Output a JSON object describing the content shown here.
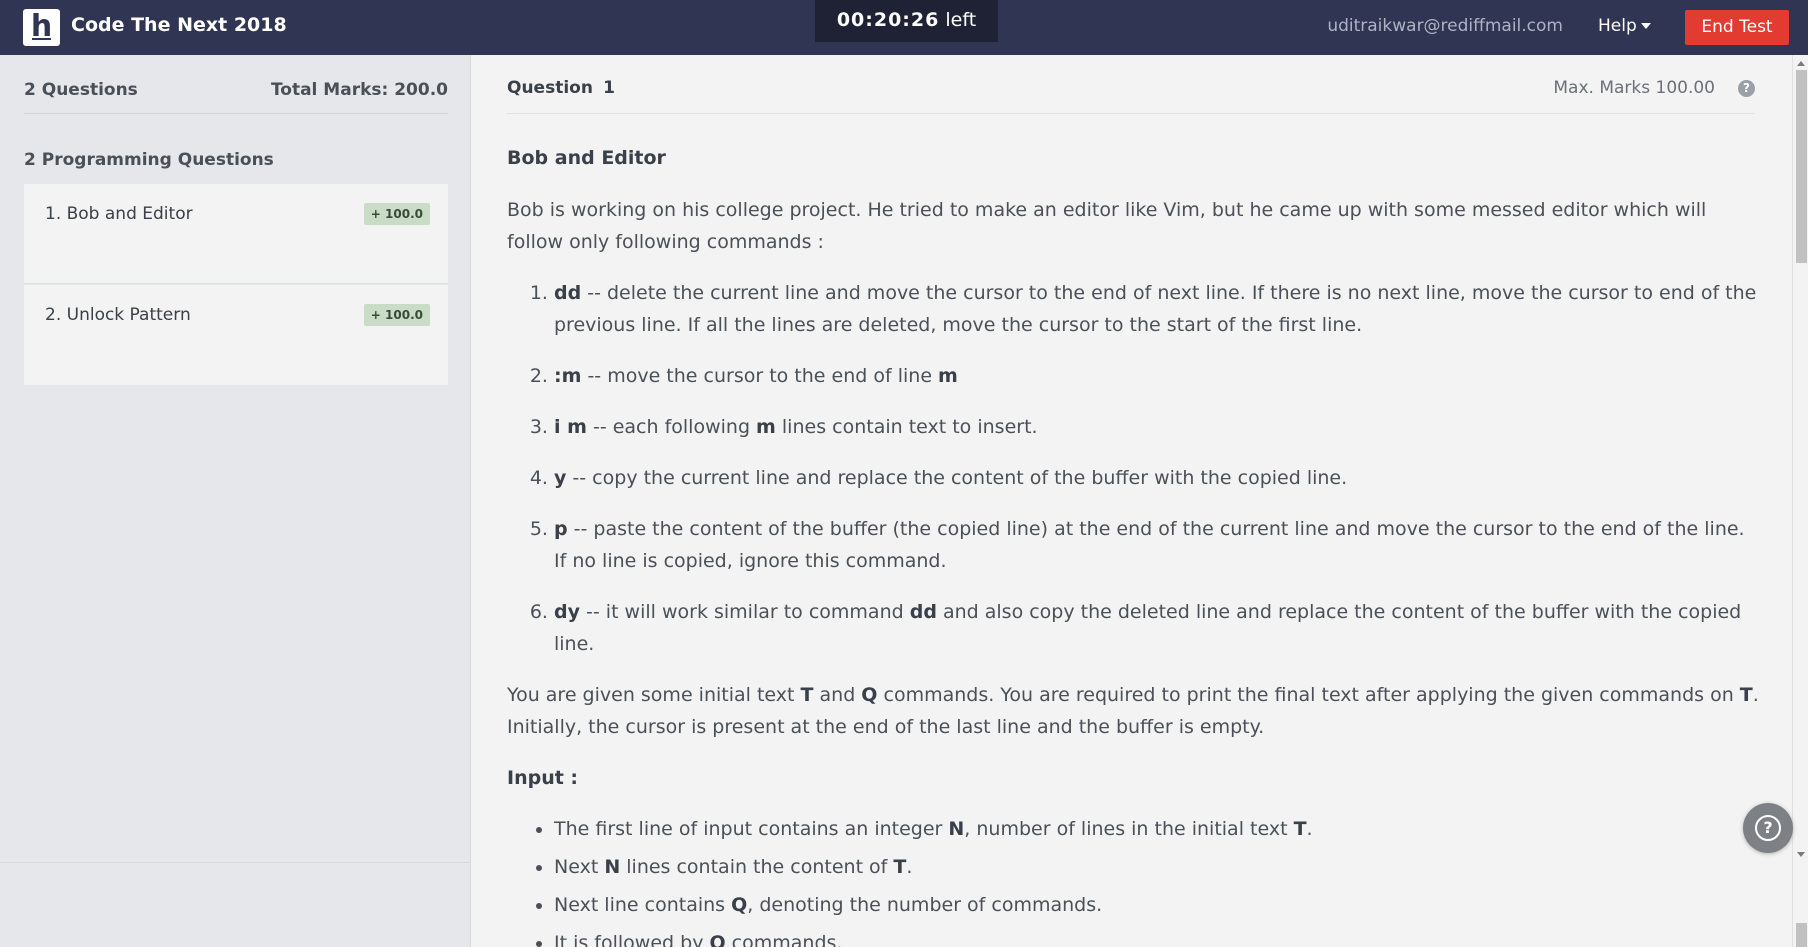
{
  "header": {
    "logo_letter": "h",
    "app_title": "Code The Next 2018",
    "timer": {
      "time": "00:20:26",
      "suffix": "left"
    },
    "user_email": "uditraikwar@rediffmail.com",
    "help_label": "Help",
    "end_test_label": "End Test"
  },
  "sidebar": {
    "question_count": "2 Questions",
    "total_marks": "Total Marks: 200.0",
    "section_title": "2 Programming Questions",
    "questions": [
      {
        "name": "1. Bob and Editor",
        "badge": "+ 100.0"
      },
      {
        "name": "2. Unlock Pattern",
        "badge": "+ 100.0"
      }
    ]
  },
  "question": {
    "label": "Question",
    "number": "1",
    "max_marks": "Max. Marks 100.00",
    "title": "Bob and Editor",
    "intro": "Bob is working on his college project. He tried to make an editor like Vim, but he came up with some messed editor which will follow only following commands :",
    "commands": [
      {
        "cmd": "dd",
        "text": "  -- delete the current line and move the cursor to the end of next line. If there is no next line, move the cursor to end of the previous line. If all the lines are deleted, move the cursor to the start of the first line."
      },
      {
        "cmd": ":m",
        "text": "  -- move the cursor to the end of line ",
        "tail_bold": "m"
      },
      {
        "cmd": "i m",
        "text": " -- each following ",
        "mid_bold": "m",
        "text2": " lines contain text to insert."
      },
      {
        "cmd": "y",
        "text": " -- copy the current line and replace the content of the buffer with the copied line."
      },
      {
        "cmd": "p",
        "text": " -- paste the content of the buffer (the copied line) at the end of the current line and move the cursor to the end of the line. If no line is copied, ignore this command."
      },
      {
        "cmd": "dy",
        "text": " -- it will work similar to command ",
        "mid_bold": "dd",
        "text2": " and also copy the deleted line and replace the content of the buffer with the copied line."
      }
    ],
    "given": {
      "p1": "You are given some initial text ",
      "b1": "T",
      "p2": " and ",
      "b2": "Q",
      "p3": " commands. You are required to print the final text after applying the given commands on ",
      "b3": "T",
      "p4": ". Initially, the cursor is present at the end of the last line and the buffer is empty."
    },
    "input_label": "Input :",
    "input_items": [
      {
        "a": "The first line of input contains an integer ",
        "b": "N",
        "c": ", number of lines in the initial text ",
        "d": "T",
        "e": "."
      },
      {
        "a": "Next ",
        "b": "N",
        "c": " lines contain the content of ",
        "d": "T",
        "e": "."
      },
      {
        "a": "Next line contains ",
        "b": "Q",
        "c": ", denoting the number of commands.",
        "d": "",
        "e": ""
      },
      {
        "a": "It is followed by ",
        "b": "Q",
        "c": " commands.",
        "d": "",
        "e": ""
      }
    ]
  },
  "help_fab_icon": "question-circle-icon"
}
